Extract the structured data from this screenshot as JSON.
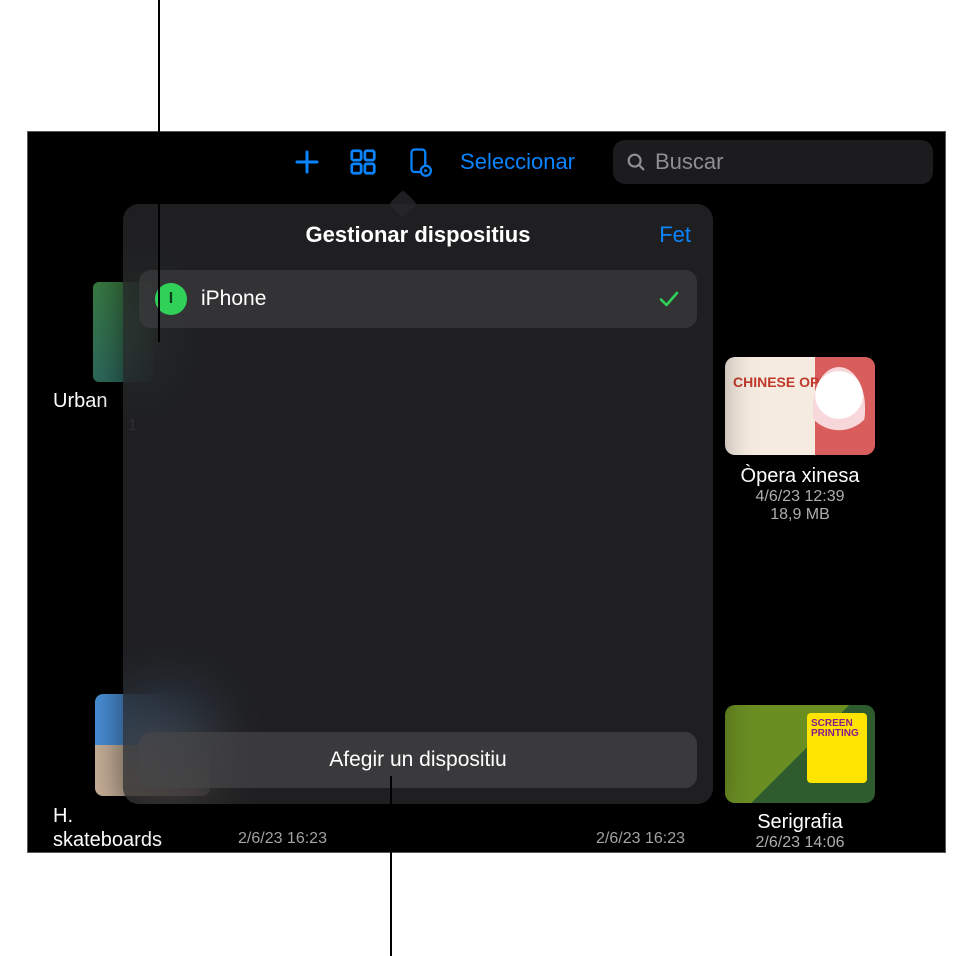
{
  "toolbar": {
    "select_label": "Seleccionar",
    "search_placeholder": "Buscar"
  },
  "popover": {
    "title": "Gestionar dispositius",
    "done_label": "Fet",
    "device_initial": "I",
    "device_name": "iPhone",
    "add_label": "Afegir un dispositiu"
  },
  "items": {
    "left": {
      "title": "Urban",
      "count": "1"
    },
    "right": {
      "title": "Òpera xinesa",
      "date": "4/6/23 12:39",
      "size": "18,9 MB",
      "thumb_text": "CHINESE OPERA"
    },
    "bl": {
      "title_line1": "H.",
      "title_line2": "skateboards"
    },
    "br": {
      "title": "Serigrafia",
      "date": "2/6/23 14:06",
      "thumb_text": "SCREEN PRINTING"
    }
  },
  "meta_row": {
    "a": "2/6/23 16:23",
    "b": "2/6/23 16:23"
  }
}
